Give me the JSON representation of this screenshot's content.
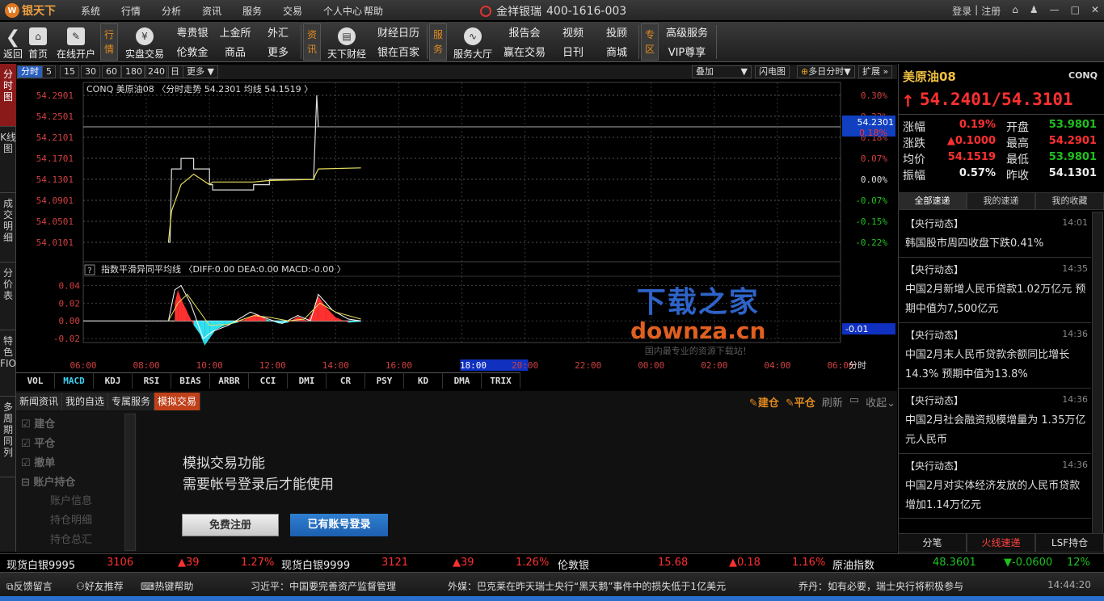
{
  "app": {
    "logo_text": "银天下",
    "logo_mark": "W",
    "brand": "金祥银瑞",
    "phone": "400-1616-003"
  },
  "menu": [
    "系统",
    "行情",
    "分析",
    "资讯",
    "服务",
    "交易",
    "个人中心",
    "帮助"
  ],
  "window": {
    "login": "登录",
    "sep": "|",
    "register": "注册",
    "home_icon": "home-icon",
    "skin_icon": "shirt-icon",
    "min": "—",
    "max": "□",
    "close": "✕"
  },
  "toolbar": {
    "back": "返回",
    "home": "首页",
    "open_account": "在线开户",
    "group_quote": "行情",
    "real_trade": "实盘交易",
    "small1": [
      "粤贵银",
      "上金所",
      "外汇",
      "伦敦金",
      "商品",
      "更多"
    ],
    "group_info": "资讯",
    "tianxia": "天下财经",
    "small2": [
      "财经日历",
      "银在百家"
    ],
    "group_service": "服务",
    "service_hall": "服务大厅",
    "small3": [
      "报告会",
      "视频",
      "投顾",
      "赢在交易",
      "日刊",
      "商城"
    ],
    "group_zone": "专区",
    "small4": [
      "高级服务",
      "VIP尊享"
    ]
  },
  "left_tabs": [
    "分时图",
    "K线图",
    "成交明细",
    "分价表",
    "特色FIO",
    "多周期同列"
  ],
  "period": {
    "items": [
      "分时",
      "5",
      "15",
      "30",
      "60",
      "180",
      "240",
      "日",
      "更多"
    ],
    "overlay": "叠加",
    "flash": "闪电图",
    "multi_day": "多日分时",
    "expand": "扩展"
  },
  "chart_data": {
    "type": "line",
    "title": "CONQ 美原油08 〈分时走势 54.2301 均线 54.1519 〉",
    "price_ticks": [
      "54.2901",
      "54.2501",
      "54.2101",
      "54.1701",
      "54.1301",
      "54.0901",
      "54.0501",
      "54.0101"
    ],
    "pct_ticks": [
      "0.30%",
      "0.22%",
      "0.18%",
      "0.07%",
      "0.00%",
      "-0.07%",
      "-0.15%",
      "-0.22%"
    ],
    "current_price_label": "54.2301",
    "current_pct_label": "0.18%",
    "ylim": [
      54.0101,
      54.2901
    ],
    "time_ticks": [
      "06:00",
      "08:00",
      "10:00",
      "12:00",
      "14:00",
      "16:00",
      "18:00",
      "20:00",
      "22:00",
      "00:00",
      "02:00",
      "04:00",
      "06:00"
    ],
    "x_unit": "分时",
    "highlight_time": "18:00",
    "price_series": [
      [
        8.7,
        54.0101
      ],
      [
        8.75,
        54.0101
      ],
      [
        8.8,
        54.15
      ],
      [
        9.1,
        54.15
      ],
      [
        9.1,
        54.17
      ],
      [
        9.5,
        54.17
      ],
      [
        9.5,
        54.15
      ],
      [
        10.0,
        54.15
      ],
      [
        10.0,
        54.12
      ],
      [
        10.1,
        54.12
      ],
      [
        10.1,
        54.11
      ],
      [
        11.4,
        54.11
      ],
      [
        11.4,
        54.12
      ],
      [
        11.9,
        54.12
      ],
      [
        11.9,
        54.13
      ],
      [
        13.3,
        54.13
      ],
      [
        13.4,
        54.2901
      ],
      [
        13.45,
        54.2301
      ]
    ],
    "avg_series": [
      [
        8.7,
        54.01
      ],
      [
        8.8,
        54.07
      ],
      [
        9.1,
        54.12
      ],
      [
        9.5,
        54.14
      ],
      [
        10.0,
        54.12
      ],
      [
        10.1,
        54.125
      ],
      [
        11.4,
        54.125
      ],
      [
        11.9,
        54.128
      ],
      [
        13.3,
        54.13
      ],
      [
        13.35,
        54.138
      ],
      [
        13.45,
        54.15
      ],
      [
        14.8,
        54.1519
      ]
    ],
    "macd_title": "指数平滑异同平均线 〈DIFF:0.00 DEA:0.00 MACD:-0.00 〉",
    "macd_ticks": [
      "0.04",
      "0.02",
      "0.00",
      "-0.02"
    ],
    "macd_ylim": [
      -0.03,
      0.045
    ],
    "macd_current": "-0.01",
    "macd_bars": [
      [
        8.9,
        0.02
      ],
      [
        9.0,
        0.035
      ],
      [
        9.1,
        0.025
      ],
      [
        9.3,
        0.01
      ],
      [
        9.5,
        -0.005
      ],
      [
        9.7,
        -0.015
      ],
      [
        9.85,
        -0.028
      ],
      [
        10.0,
        -0.02
      ],
      [
        10.2,
        -0.01
      ],
      [
        10.5,
        -0.005
      ],
      [
        10.9,
        -0.002
      ],
      [
        11.2,
        0.003
      ],
      [
        11.5,
        0.008
      ],
      [
        11.8,
        0.002
      ],
      [
        12.2,
        -0.003
      ],
      [
        12.5,
        -0.002
      ],
      [
        12.8,
        0.005
      ],
      [
        13.1,
        0.0
      ],
      [
        13.3,
        0.012
      ],
      [
        13.45,
        0.028
      ],
      [
        13.7,
        0.015
      ],
      [
        14.0,
        0.004
      ],
      [
        14.4,
        -0.002
      ],
      [
        14.8,
        -0.001
      ]
    ],
    "macd_diff": [
      [
        8.7,
        0.0
      ],
      [
        8.9,
        0.035
      ],
      [
        9.1,
        0.04
      ],
      [
        9.4,
        0.02
      ],
      [
        9.8,
        -0.02
      ],
      [
        10.1,
        -0.012
      ],
      [
        10.6,
        -0.005
      ],
      [
        11.3,
        0.01
      ],
      [
        11.7,
        0.004
      ],
      [
        12.3,
        -0.003
      ],
      [
        12.8,
        0.006
      ],
      [
        13.2,
        0.0
      ],
      [
        13.45,
        0.03
      ],
      [
        13.9,
        0.012
      ],
      [
        14.4,
        0.002
      ],
      [
        14.8,
        0.0
      ]
    ],
    "macd_dea": [
      [
        8.7,
        0.0
      ],
      [
        9.0,
        0.02
      ],
      [
        9.3,
        0.03
      ],
      [
        9.7,
        0.01
      ],
      [
        10.0,
        -0.005
      ],
      [
        10.6,
        -0.004
      ],
      [
        11.4,
        0.006
      ],
      [
        11.9,
        0.004
      ],
      [
        12.5,
        0.0
      ],
      [
        13.0,
        0.002
      ],
      [
        13.5,
        0.02
      ],
      [
        14.0,
        0.01
      ],
      [
        14.8,
        0.002
      ]
    ]
  },
  "indicators": [
    "VOL",
    "MACD",
    "KDJ",
    "RSI",
    "BIAS",
    "ARBR",
    "CCI",
    "DMI",
    "CR",
    "PSY",
    "KD",
    "DMA",
    "TRIX"
  ],
  "bottom": {
    "tabs": [
      "新闻资讯",
      "我的自选",
      "专属服务",
      "模拟交易"
    ],
    "tools": {
      "build": "建仓",
      "close": "平仓",
      "refresh": "刷新",
      "collapse": "收起"
    },
    "side_items": [
      "建仓",
      "平仓",
      "撤单",
      "账户持仓"
    ],
    "side_sub": [
      "账户信息",
      "持仓明细",
      "持仓总汇"
    ],
    "notice_line1": "模拟交易功能",
    "notice_line2": "需要帐号登录后才能使用",
    "register": "免费注册",
    "login": "已有账号登录"
  },
  "quote": {
    "name": "美原油08",
    "code": "CONQ",
    "price": "54.2401/54.3101",
    "rows": [
      {
        "l1": "涨幅",
        "v1": "0.19%",
        "l2": "开盘",
        "v2": "53.9801",
        "c1": "#ff3030",
        "c2": "#20c020"
      },
      {
        "l1": "涨跌",
        "v1": "▲0.1000",
        "l2": "最高",
        "v2": "54.2901",
        "c1": "#ff3030",
        "c2": "#ff3030"
      },
      {
        "l1": "均价",
        "v1": "54.1519",
        "l2": "最低",
        "v2": "53.9801",
        "c1": "#ff3030",
        "c2": "#20c020"
      },
      {
        "l1": "振幅",
        "v1": "0.57%",
        "l2": "昨收",
        "v2": "54.1301",
        "c1": "#eeeeee",
        "c2": "#eeeeee"
      }
    ]
  },
  "news_tabs": [
    "全部速递",
    "我的速递",
    "我的收藏"
  ],
  "news": [
    {
      "head": "【央行动态】",
      "time": "14:01",
      "body": "韩国股市周四收盘下跌0.41%"
    },
    {
      "head": "【央行动态】",
      "time": "14:35",
      "body": "中国2月新增人民币贷款1.02万亿元 预期中值为7,500亿元"
    },
    {
      "head": "【央行动态】",
      "time": "14:36",
      "body": "中国2月末人民币贷款余额同比增长14.3% 预期中值为13.8%"
    },
    {
      "head": "【央行动态】",
      "time": "14:36",
      "body": "中国2月社会融资规模增量为 1.35万亿元人民币"
    },
    {
      "head": "【央行动态】",
      "time": "14:36",
      "body": "中国2月对实体经济发放的人民币贷款增加1.14万亿元"
    }
  ],
  "right_bottom_tabs": [
    "分笔",
    "火线速递",
    "LSF持仓"
  ],
  "ticker": [
    {
      "name": "现货白银9995",
      "price": "3106",
      "chg": "▲39",
      "pct": "1.27%"
    },
    {
      "name": "现货白银9999",
      "price": "3121",
      "chg": "▲39",
      "pct": "1.26%"
    },
    {
      "name": "伦敦银",
      "price": "15.68",
      "chg": "▲0.18",
      "pct": "1.16%"
    },
    {
      "name": "原油指数",
      "price": "48.3601",
      "chg": "▼-0.0600",
      "pct": "12%"
    }
  ],
  "status": {
    "feedback": "反馈留言",
    "recommend": "好友推荐",
    "hotkey": "热键帮助",
    "scroll": [
      "习近平：中国要完善资产监督管理",
      "外媒：巴克莱在昨天瑞士央行“黑天鹅”事件中的损失低于1亿美元",
      "乔丹：如有必要，瑞士央行将积极参与"
    ],
    "clock": "14:44:20"
  },
  "watermark": {
    "line1": "下载之家",
    "line2": "downza.cn",
    "line3": "国内最专业的资源下载站！"
  }
}
